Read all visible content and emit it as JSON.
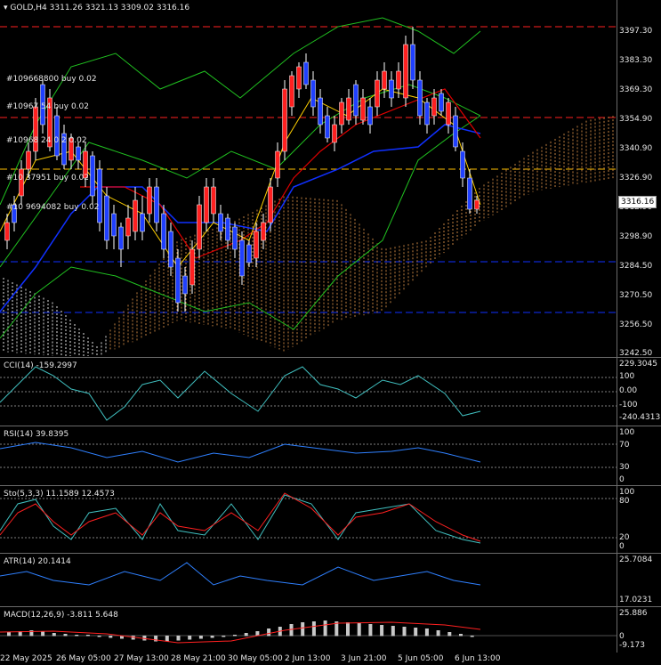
{
  "header": {
    "symbol": "GOLD,H4",
    "ohlc": "3311.26 3321.13 3309.02 3316.16"
  },
  "orders": [
    "#109668800 buy 0.02",
    "#10967 54 buy 0.02",
    "#10968 24 0 2 0.02",
    "#10 37951 buy 0.02",
    "#10 9694082 buy 0.02"
  ],
  "price_axis": [
    "3397.30",
    "3383.30",
    "3369.30",
    "3354.90",
    "3340.90",
    "3326.90",
    "3312.90",
    "3298.90",
    "3284.50",
    "3270.50",
    "3256.50",
    "3242.50"
  ],
  "current_price": "3316.16",
  "cci": {
    "title": "CCI(14) -159.2997",
    "ticks": [
      "229.3045",
      "100",
      "0.00",
      "-100",
      "-240.4313"
    ]
  },
  "rsi": {
    "title": "RSI(14) 39.8395",
    "ticks": [
      "100",
      "70",
      "30",
      "0"
    ]
  },
  "sto": {
    "title": "Sto(5,3,3) 11.1589 12.4573",
    "ticks": [
      "100",
      "80",
      "20",
      "0"
    ]
  },
  "atr": {
    "title": "ATR(14) 20.1414",
    "ticks": [
      "25.7084",
      "17.0231"
    ]
  },
  "macd": {
    "title": "MACD(12,26,9) -3.811 5.648",
    "ticks": [
      "25.886",
      "0",
      "-9.173"
    ]
  },
  "time_axis": [
    "22 May 2025",
    "26 May 05:00",
    "27 May 13:00",
    "28 May 21:00",
    "30 May 05:00",
    "2 Jun 13:00",
    "3 Jun 21:00",
    "5 Jun 05:00",
    "6 Jun 13:00"
  ],
  "colors": {
    "bull": "#ff2020",
    "bear": "#2040ff",
    "doji": "#ffffff",
    "ma_fast": "#ffd000",
    "ma_slow": "#e00000",
    "kijun": "#1030ff",
    "bands": "#20c020",
    "cloud": "#c08040",
    "level_red": "#ff2020",
    "level_yellow": "#ffc000",
    "level_blue": "#1030ff",
    "cci_line": "#40c0c0",
    "rsi_line": "#2f80ff",
    "sto_main": "#40c0c0",
    "sto_signal": "#ff2020",
    "atr_line": "#2f80ff",
    "macd_hist": "#c8c8c8",
    "macd_signal": "#ff2020"
  }
}
